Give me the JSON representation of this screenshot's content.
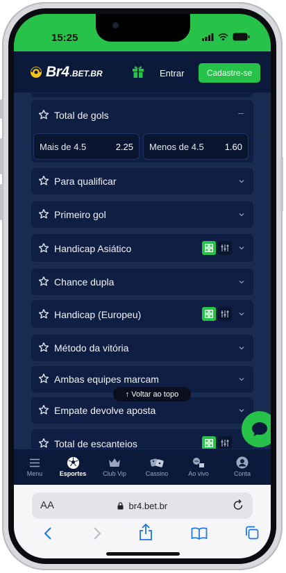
{
  "status_bar": {
    "time": "15:25"
  },
  "header": {
    "logo_main": "Br4",
    "logo_sub": ".BET.BR",
    "login_label": "Entrar",
    "signup_label": "Cadastre-se"
  },
  "total_gols": {
    "name": "Total de gols",
    "collapse_symbol": "–",
    "odds": [
      {
        "label": "Mais de 4.5",
        "value": "2.25"
      },
      {
        "label": "Menos de 4.5",
        "value": "1.60"
      }
    ]
  },
  "markets": [
    {
      "name": "Para qualificar"
    },
    {
      "name": "Primeiro gol"
    },
    {
      "name": "Handicap Asiático"
    },
    {
      "name": "Chance dupla"
    },
    {
      "name": "Handicap (Europeu)"
    },
    {
      "name": "Método da vitória"
    },
    {
      "name": "Ambas equipes marcam"
    },
    {
      "name": "Empate devolve aposta"
    },
    {
      "name": "Total de escanteios"
    }
  ],
  "back_to_top": "Voltar ao topo",
  "bottom_nav": [
    {
      "label": "Menu",
      "icon": "menu-icon"
    },
    {
      "label": "Esportes",
      "icon": "soccer-ball-icon",
      "active": true
    },
    {
      "label": "Club Vip",
      "icon": "crown-icon"
    },
    {
      "label": "Cassino",
      "icon": "dice-icon"
    },
    {
      "label": "Ao vivo",
      "icon": "live-icon"
    },
    {
      "label": "Conta",
      "icon": "user-icon"
    }
  ],
  "browser": {
    "text_size_label": "AA",
    "url": "br4.bet.br"
  },
  "colors": {
    "brand_green": "#27c24a",
    "header_bg": "#0b1a3a",
    "content_bg": "#1a2b52",
    "card_bg": "#0f1f44"
  }
}
